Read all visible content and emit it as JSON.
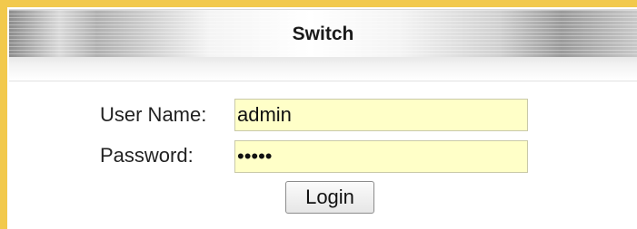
{
  "window": {
    "title": "Switch"
  },
  "login_form": {
    "username_label": "User Name:",
    "username_value": "admin",
    "password_label": "Password:",
    "password_value": "admin",
    "login_button_label": "Login"
  },
  "colors": {
    "outer_border": "#f2c94c",
    "input_background": "#ffffc8"
  }
}
